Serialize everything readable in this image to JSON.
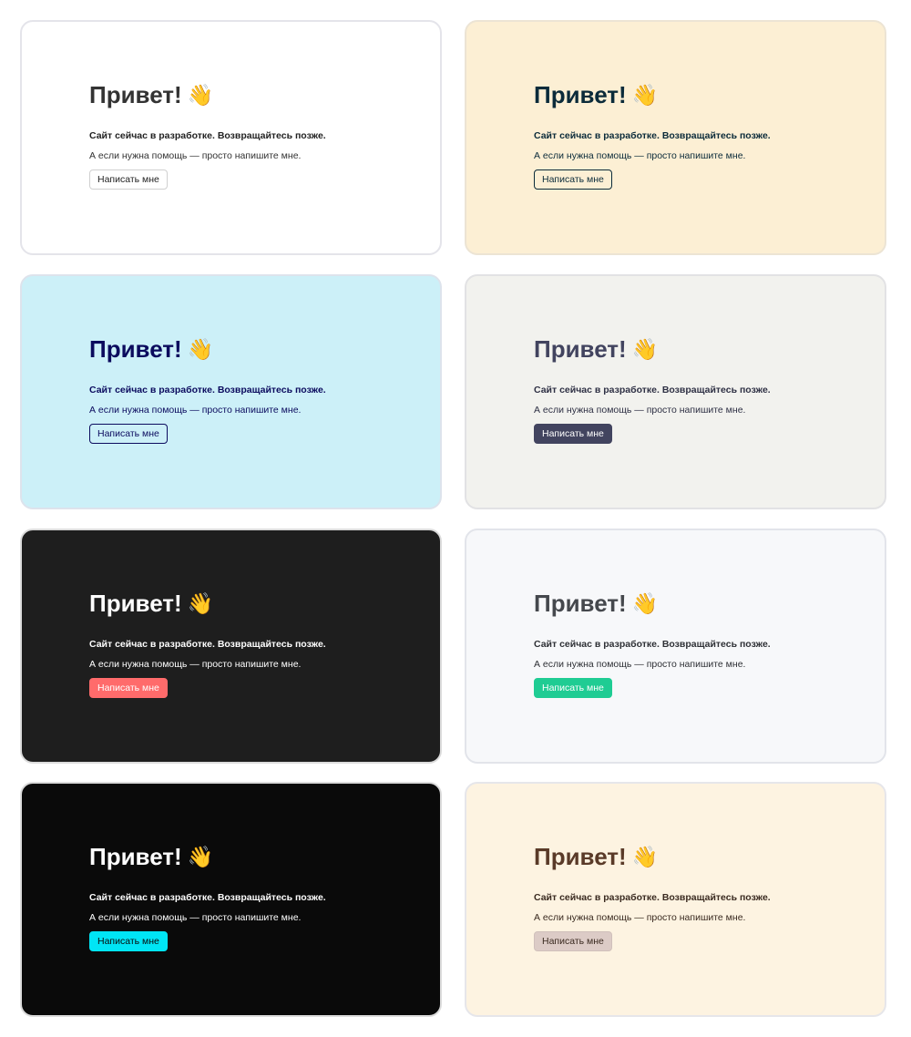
{
  "variants": [
    {
      "id": "light",
      "heading": "Привет!",
      "wave_icon": "👋",
      "lead": "Сайт сейчас в разработке. Возвращайтесь позже.",
      "help": "А если нужна помощь — просто напишите мне.",
      "button_label": "Написать мне",
      "colors": {
        "background": "#ffffff",
        "border": "#e4e4ea",
        "heading": "#333333",
        "lead": "#222222",
        "help": "#333333",
        "button_bg": "#ffffff",
        "button_text": "#222222",
        "button_border": "#d0d0d0"
      }
    },
    {
      "id": "sand",
      "heading": "Привет!",
      "wave_icon": "👋",
      "lead": "Сайт сейчас в разработке. Возвращайтесь позже.",
      "help": "А если нужна помощь — просто напишите мне.",
      "button_label": "Написать мне",
      "colors": {
        "background": "#fcefd4",
        "border": "#ece4d4",
        "heading": "#0b2b3a",
        "lead": "#0b2b3a",
        "help": "#0b2b3a",
        "button_bg": "#fcefd4",
        "button_text": "#0b2b3a",
        "button_border": "#0b2b3a"
      }
    },
    {
      "id": "sky",
      "heading": "Привет!",
      "wave_icon": "👋",
      "lead": "Сайт сейчас в разработке. Возвращайтесь позже.",
      "help": "А если нужна помощь — просто напишите мне.",
      "button_label": "Написать мне",
      "colors": {
        "background": "#ccf0f8",
        "border": "#dde3ec",
        "heading": "#0b0b5e",
        "lead": "#0b0b5e",
        "help": "#0b0b5e",
        "button_bg": "#ccf0f8",
        "button_text": "#0b0b5e",
        "button_border": "#0b0b5e"
      }
    },
    {
      "id": "stone",
      "heading": "Привет!",
      "wave_icon": "👋",
      "lead": "Сайт сейчас в разработке. Возвращайтесь позже.",
      "help": "А если нужна помощь — просто напишите мне.",
      "button_label": "Написать мне",
      "colors": {
        "background": "#f2f2ee",
        "border": "#e2e2e4",
        "heading": "#42445f",
        "lead": "#2e3044",
        "help": "#2e3044",
        "button_bg": "#42445f",
        "button_text": "#ffffff",
        "button_border": "#42445f"
      }
    },
    {
      "id": "charcoal",
      "heading": "Привет!",
      "wave_icon": "👋",
      "lead": "Сайт сейчас в разработке. Возвращайтесь позже.",
      "help": "А если нужна помощь — просто напишите мне.",
      "button_label": "Написать мне",
      "colors": {
        "background": "#1e1e1e",
        "border": "#dcdcdc",
        "heading": "#ffffff",
        "lead": "#ffffff",
        "help": "#ffffff",
        "button_bg": "#ff6b6b",
        "button_text": "#ffffff",
        "button_border": "#ff6b6b"
      }
    },
    {
      "id": "mint",
      "heading": "Привет!",
      "wave_icon": "👋",
      "lead": "Сайт сейчас в разработке. Возвращайтесь позже.",
      "help": "А если нужна помощь — просто напишите мне.",
      "button_label": "Написать мне",
      "colors": {
        "background": "#f7f8fa",
        "border": "#e2e4ea",
        "heading": "#45484d",
        "lead": "#2e3035",
        "help": "#2e3035",
        "button_bg": "#1fcc93",
        "button_text": "#ffffff",
        "button_border": "#1fcc93"
      }
    },
    {
      "id": "black",
      "heading": "Привет!",
      "wave_icon": "👋",
      "lead": "Сайт сейчас в разработке. Возвращайтесь позже.",
      "help": "А если нужна помощь — просто напишите мне.",
      "button_label": "Написать мне",
      "colors": {
        "background": "#0a0a0a",
        "border": "#dcdcdc",
        "heading": "#ffffff",
        "lead": "#ffffff",
        "help": "#ffffff",
        "button_bg": "#00e5f5",
        "button_text": "#0a0a0a",
        "button_border": "#00e5f5"
      }
    },
    {
      "id": "cream",
      "heading": "Привет!",
      "wave_icon": "👋",
      "lead": "Сайт сейчас в разработке. Возвращайтесь позже.",
      "help": "А если нужна помощь — просто напишите мне.",
      "button_label": "Написать мне",
      "colors": {
        "background": "#fdf3e1",
        "border": "#e6e6ea",
        "heading": "#5a3a28",
        "lead": "#3a2a20",
        "help": "#3a2a20",
        "button_bg": "#dccbc6",
        "button_text": "#3a2a20",
        "button_border": "#d0c0bb"
      }
    }
  ]
}
